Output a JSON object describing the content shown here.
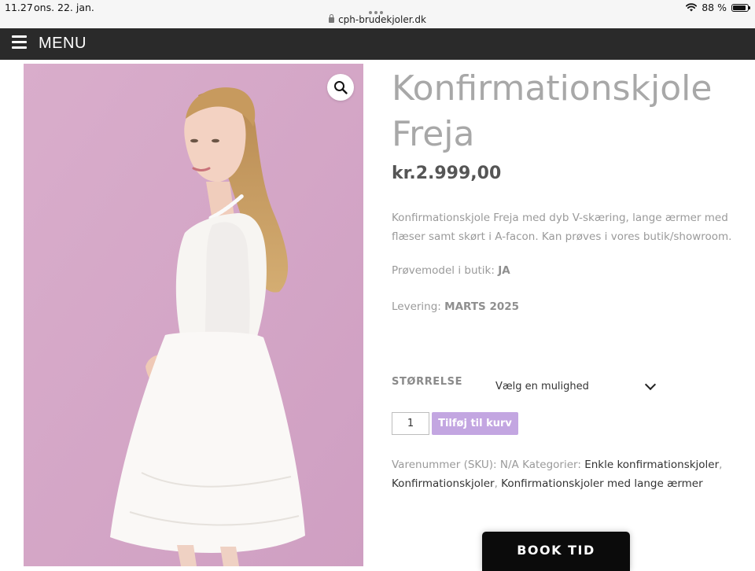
{
  "status_bar": {
    "time": "11.27",
    "date": "ons. 22. jan.",
    "url": "cph-brudekjoler.dk",
    "battery_text": "88 %",
    "battery_level": 0.88,
    "icons": [
      "wifi-icon",
      "battery-icon",
      "lock-icon"
    ]
  },
  "menu": {
    "label": "MENU",
    "icon": "hamburger-icon"
  },
  "product": {
    "image_alt": "Konfirmationskjole Freja",
    "zoom_icon": "search-icon",
    "title": "Konfirmationskjole Freja",
    "price": "kr.2.999,00",
    "description": "Konfirmationskjole Freja med dyb V-skæring, lange ærmer med flæser samt skørt i A-facon. Kan prøves i vores butik/showroom.",
    "proeve_label": "Prøvemodel i butik: ",
    "proeve_value": "JA",
    "levering_label": "Levering: ",
    "levering_value": "MARTS 2025",
    "size_label": "STØRRELSE",
    "size_selected": "Vælg en mulighed",
    "quantity": "1",
    "add_to_cart": "Tilføj til kurv",
    "sku_label": "Varenummer (SKU):",
    "sku_value": "N/A",
    "categories_label": "Kategorier:",
    "categories": [
      "Enkle konfirmationskjoler",
      "Konfirmationskjoler",
      "Konfirmationskjoler med lange ærmer"
    ]
  },
  "book_button": "BOOK TID",
  "colors": {
    "menu_bg": "#2a2a2a",
    "image_bg": "#d6a7c9",
    "add_button": "#c3a6e1",
    "title_text": "#a8a8a8",
    "book_button": "#0b0b0b"
  }
}
